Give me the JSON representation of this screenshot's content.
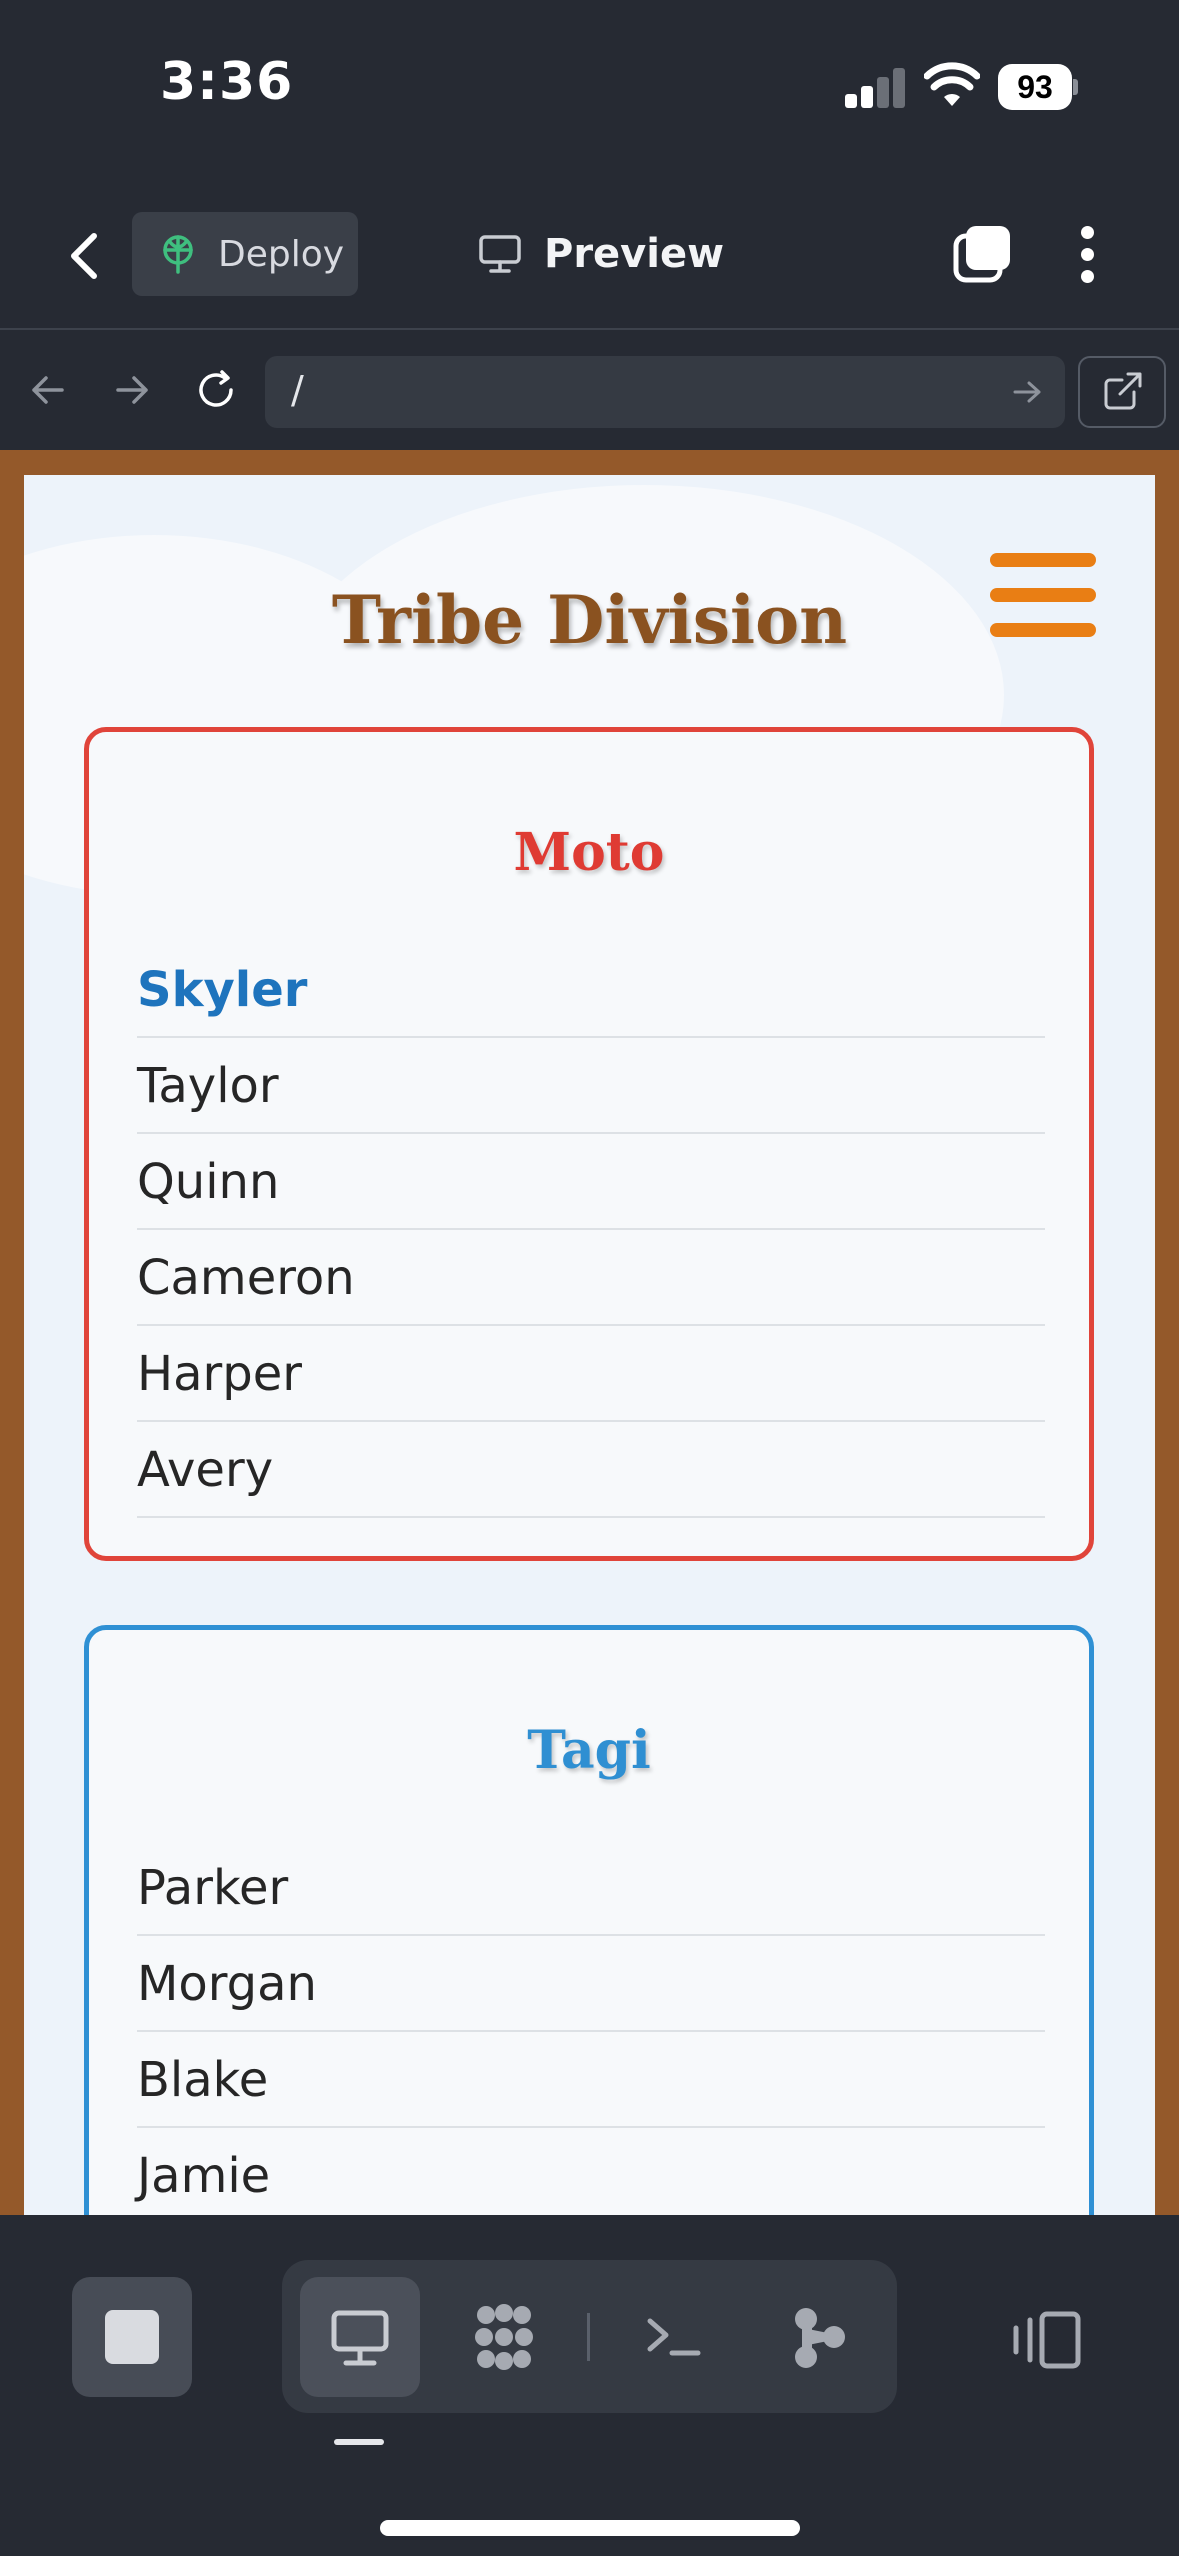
{
  "status_bar": {
    "time": "3:36",
    "battery": "93",
    "icons": [
      "signal-icon",
      "wifi-icon",
      "battery-icon"
    ]
  },
  "app_toolbar": {
    "deploy_label": "Deploy",
    "preview_label": "Preview",
    "icons": [
      "chevron-left-icon",
      "deploy-icon",
      "monitor-icon",
      "tabs-icon",
      "more-vertical-icon"
    ]
  },
  "browser_bar": {
    "url": "/",
    "icons": [
      "arrow-left-icon",
      "arrow-right-icon",
      "reload-icon",
      "go-arrow-icon",
      "external-link-icon"
    ]
  },
  "page": {
    "title": "Tribe Division",
    "accent_color": "#e97e14",
    "tribes": [
      {
        "name": "Moto",
        "color": "#e0443a",
        "members": [
          "Skyler",
          "Taylor",
          "Quinn",
          "Cameron",
          "Harper",
          "Avery"
        ],
        "highlighted_member": "Skyler"
      },
      {
        "name": "Tagi",
        "color": "#2f90d4",
        "members": [
          "Parker",
          "Morgan",
          "Blake",
          "Jamie"
        ]
      }
    ]
  },
  "bottom_bar": {
    "tools": [
      "monitor-icon",
      "grid-icon",
      "terminal-icon",
      "git-branch-icon"
    ],
    "active_tool": "monitor-icon"
  }
}
